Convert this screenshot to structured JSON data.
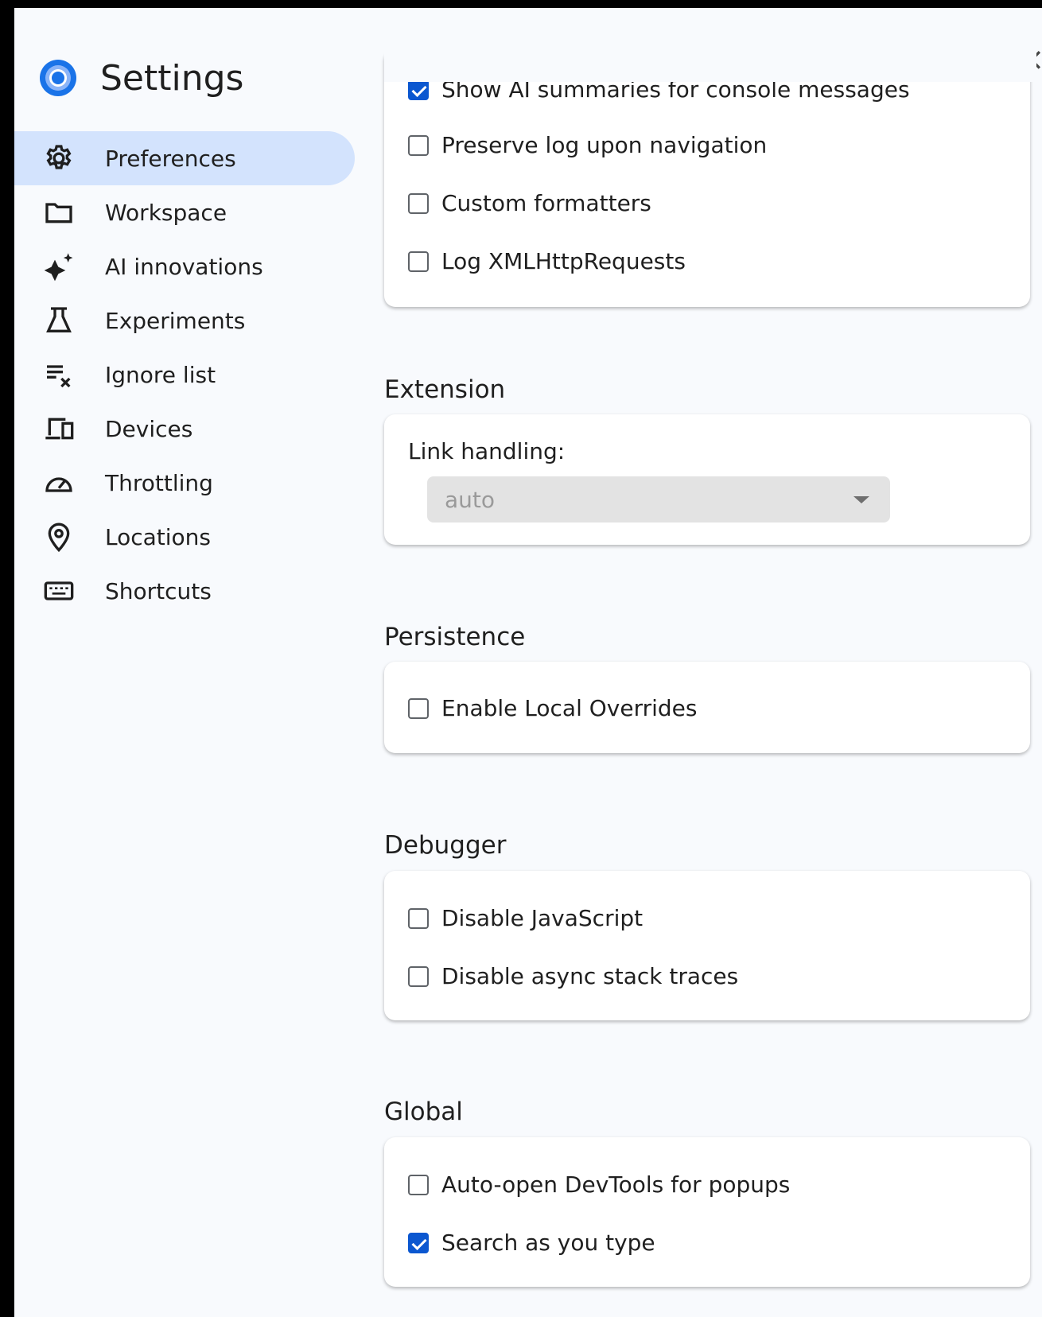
{
  "header": {
    "title": "Settings",
    "close_label": "×"
  },
  "sidebar": {
    "items": [
      {
        "label": "Preferences",
        "icon": "gear-icon",
        "active": true
      },
      {
        "label": "Workspace",
        "icon": "folder-icon"
      },
      {
        "label": "AI innovations",
        "icon": "sparkle-icon"
      },
      {
        "label": "Experiments",
        "icon": "flask-icon"
      },
      {
        "label": "Ignore list",
        "icon": "ignore-list-icon"
      },
      {
        "label": "Devices",
        "icon": "devices-icon"
      },
      {
        "label": "Throttling",
        "icon": "speedometer-icon"
      },
      {
        "label": "Locations",
        "icon": "location-pin-icon"
      },
      {
        "label": "Shortcuts",
        "icon": "keyboard-icon"
      }
    ]
  },
  "console": {
    "items": [
      {
        "label": "Show AI summaries for console messages",
        "checked": true
      },
      {
        "label": "Preserve log upon navigation",
        "checked": false
      },
      {
        "label": "Custom formatters",
        "checked": false
      },
      {
        "label": "Log XMLHttpRequests",
        "checked": false
      }
    ]
  },
  "extension": {
    "title": "Extension",
    "link_label": "Link handling:",
    "link_value": "auto"
  },
  "persistence": {
    "title": "Persistence",
    "items": [
      {
        "label": "Enable Local Overrides",
        "checked": false
      }
    ]
  },
  "debugger": {
    "title": "Debugger",
    "items": [
      {
        "label": "Disable JavaScript",
        "checked": false
      },
      {
        "label": "Disable async stack traces",
        "checked": false
      }
    ]
  },
  "global": {
    "title": "Global",
    "items": [
      {
        "label": "Auto-open DevTools for popups",
        "checked": false
      },
      {
        "label": "Search as you type",
        "checked": true
      }
    ]
  },
  "colors": {
    "accent": "#0b57d0",
    "active_nav": "#d3e3fd",
    "background": "#f8fafd"
  }
}
